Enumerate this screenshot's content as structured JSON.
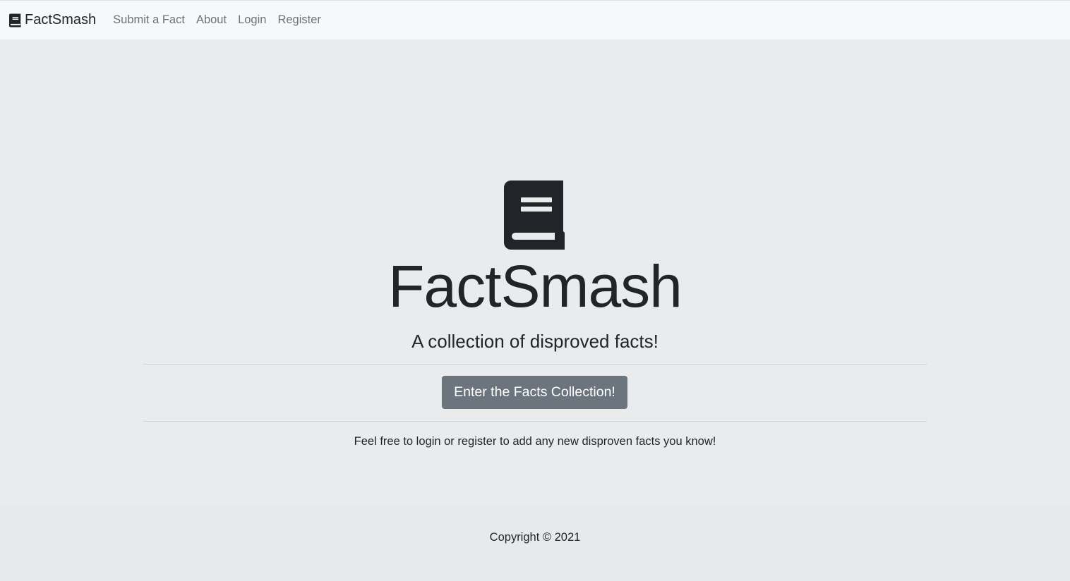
{
  "navbar": {
    "brand_icon": "book-icon",
    "brand_label": "FactSmash",
    "links": [
      {
        "label": "Submit a Fact"
      },
      {
        "label": "About"
      },
      {
        "label": "Login"
      },
      {
        "label": "Register"
      }
    ]
  },
  "hero": {
    "icon": "book-icon",
    "title": "FactSmash",
    "subtitle": "A collection of disproved facts!",
    "cta_label": "Enter the Facts Collection!",
    "note": "Feel free to login or register to add any new disproven facts you know!"
  },
  "footer": {
    "copyright": "Copyright © 2021"
  },
  "colors": {
    "text": "#212529",
    "nav_link": "#6e7378",
    "button_bg": "#6c757d",
    "button_text": "#ffffff",
    "navbar_bg": "#f7f8f9",
    "page_bg": "#eaebec",
    "footer_bg": "#e7eaed"
  }
}
